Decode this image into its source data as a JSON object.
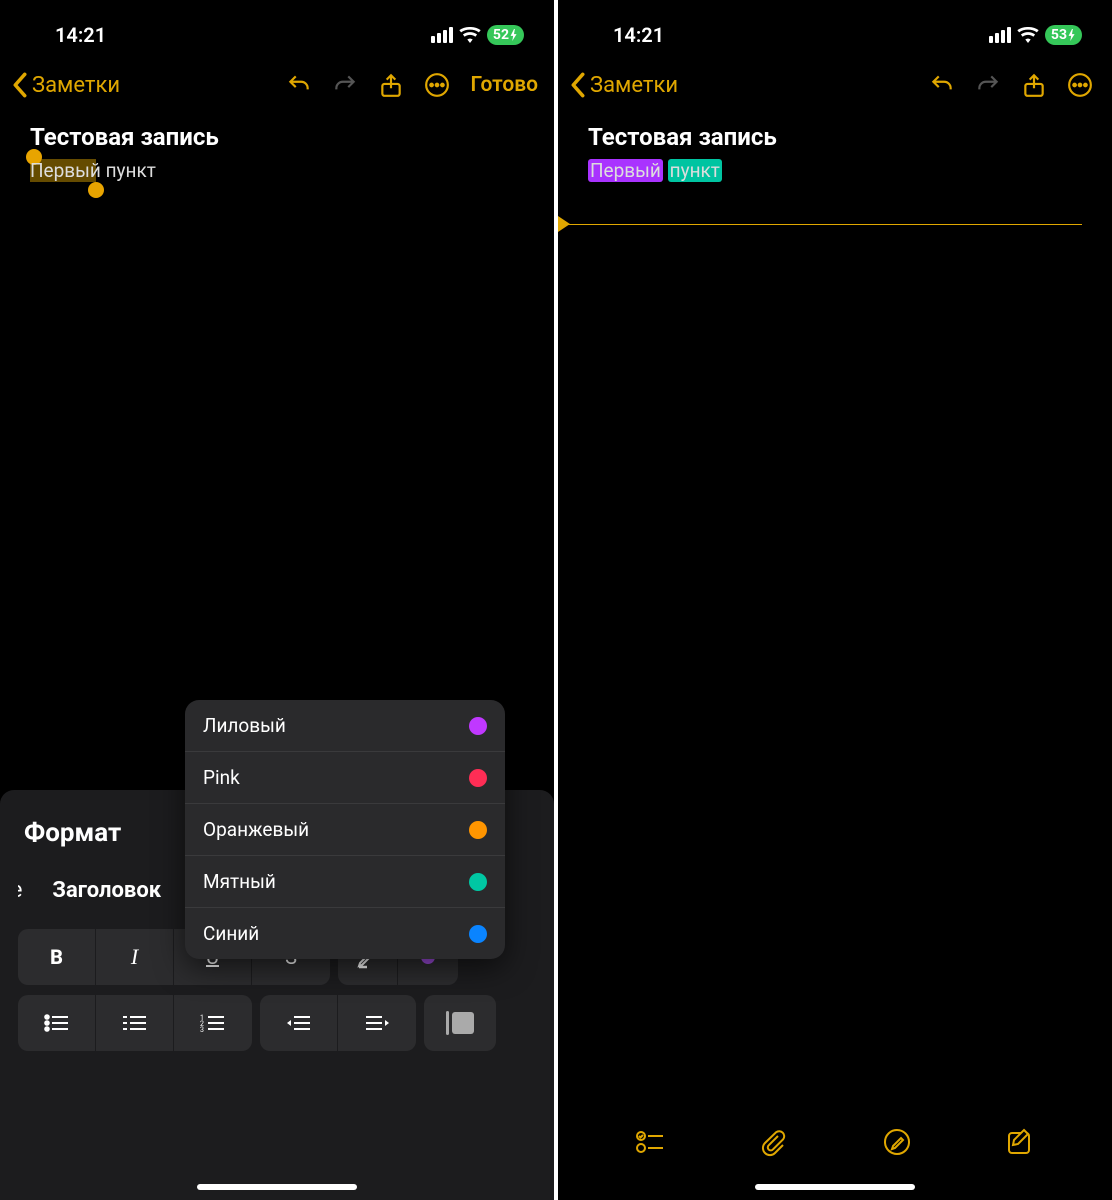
{
  "left": {
    "status": {
      "time": "14:21",
      "battery": "52"
    },
    "nav": {
      "back": "Заметки",
      "done": "Готово"
    },
    "note": {
      "title": "Тестовая запись",
      "line": "Первый пункт",
      "selected": "Первый"
    },
    "format": {
      "title": "Формат",
      "style_prev": "ие",
      "style_heading": "Заголовок",
      "edge_letter": "E",
      "b": "B",
      "i": "I",
      "u": "U",
      "s": "S"
    },
    "colors": [
      {
        "label": "Лиловый",
        "hex": "#c038ff"
      },
      {
        "label": "Pink",
        "hex": "#ff2d55"
      },
      {
        "label": "Оранжевый",
        "hex": "#ff9500"
      },
      {
        "label": "Мятный",
        "hex": "#00c7a3"
      },
      {
        "label": "Синий",
        "hex": "#0a84ff"
      }
    ]
  },
  "right": {
    "status": {
      "time": "14:21",
      "battery": "53"
    },
    "nav": {
      "back": "Заметки"
    },
    "note": {
      "title": "Тестовая запись",
      "word1": "Первый",
      "word2": "пункт"
    }
  }
}
